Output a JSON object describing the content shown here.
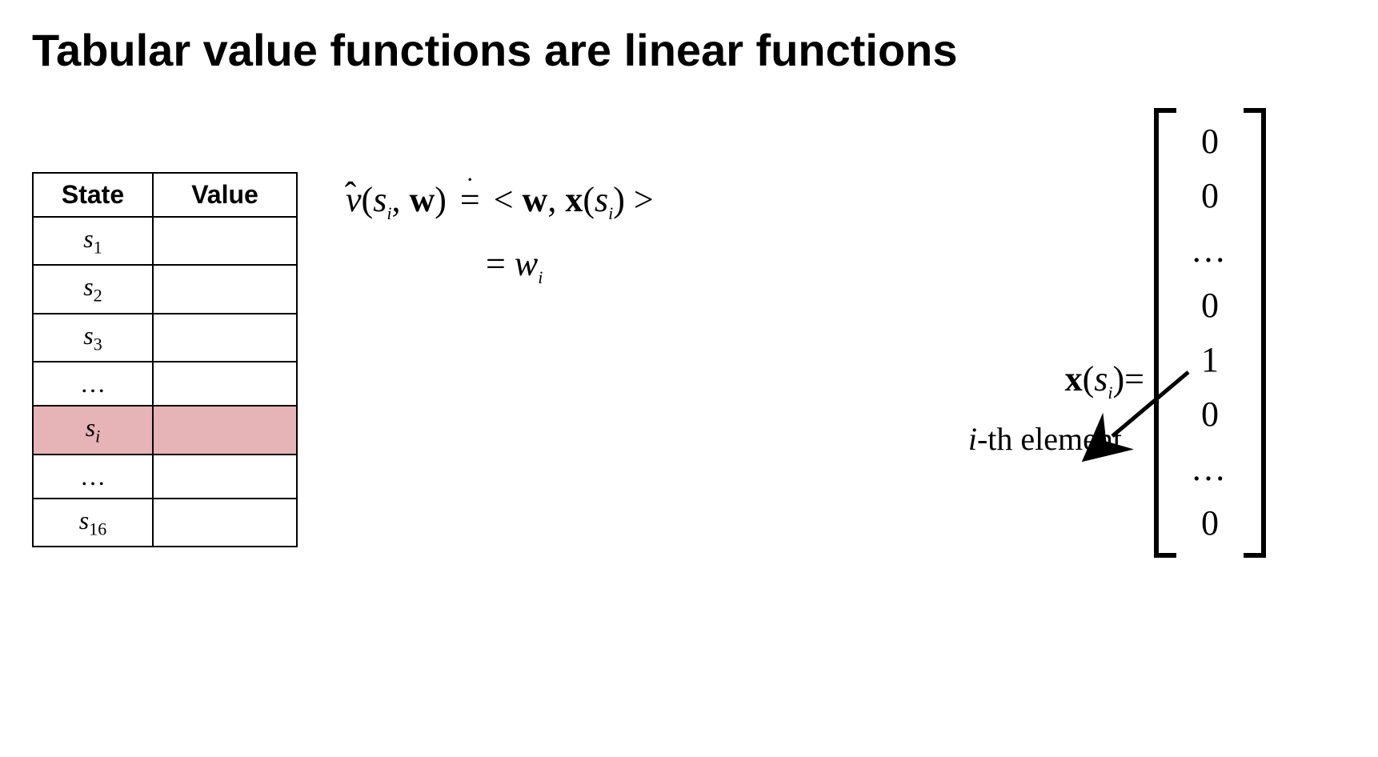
{
  "title": "Tabular value functions are linear functions",
  "table": {
    "headers": {
      "state": "State",
      "value": "Value"
    },
    "rows": [
      {
        "label_base": "s",
        "label_sub": "1",
        "highlight": false
      },
      {
        "label_base": "s",
        "label_sub": "2",
        "highlight": false
      },
      {
        "label_base": "s",
        "label_sub": "3",
        "highlight": false
      },
      {
        "label_base": "…",
        "label_sub": "",
        "highlight": false
      },
      {
        "label_base": "s",
        "label_sub": "i",
        "highlight": true
      },
      {
        "label_base": "…",
        "label_sub": "",
        "highlight": false
      },
      {
        "label_base": "s",
        "label_sub": "16",
        "highlight": false
      }
    ]
  },
  "equations": {
    "line1_lhs_v": "v",
    "line1_lhs_open": "(",
    "line1_lhs_s": "s",
    "line1_lhs_sub": "i",
    "line1_lhs_comma": ", ",
    "line1_lhs_w": "w",
    "line1_lhs_close": ") ",
    "line1_eq": "=",
    "line1_rhs_open": " < ",
    "line1_rhs_w": "w",
    "line1_rhs_comma": ", ",
    "line1_rhs_x": "x",
    "line1_rhs_paren_open": "(",
    "line1_rhs_s": "s",
    "line1_rhs_sub": "i",
    "line1_rhs_paren_close": ")",
    "line1_rhs_close": " >",
    "line2_eq": "= ",
    "line2_w": "w",
    "line2_sub": "i"
  },
  "vector": {
    "label_x": "x",
    "label_open": "(",
    "label_s": "s",
    "label_sub": "i",
    "label_close": ")",
    "label_eq": "=",
    "entries": [
      "0",
      "0",
      "…",
      "0",
      "1",
      "0",
      "…",
      "0"
    ],
    "annotation_i": "i",
    "annotation_text": "-th element"
  }
}
